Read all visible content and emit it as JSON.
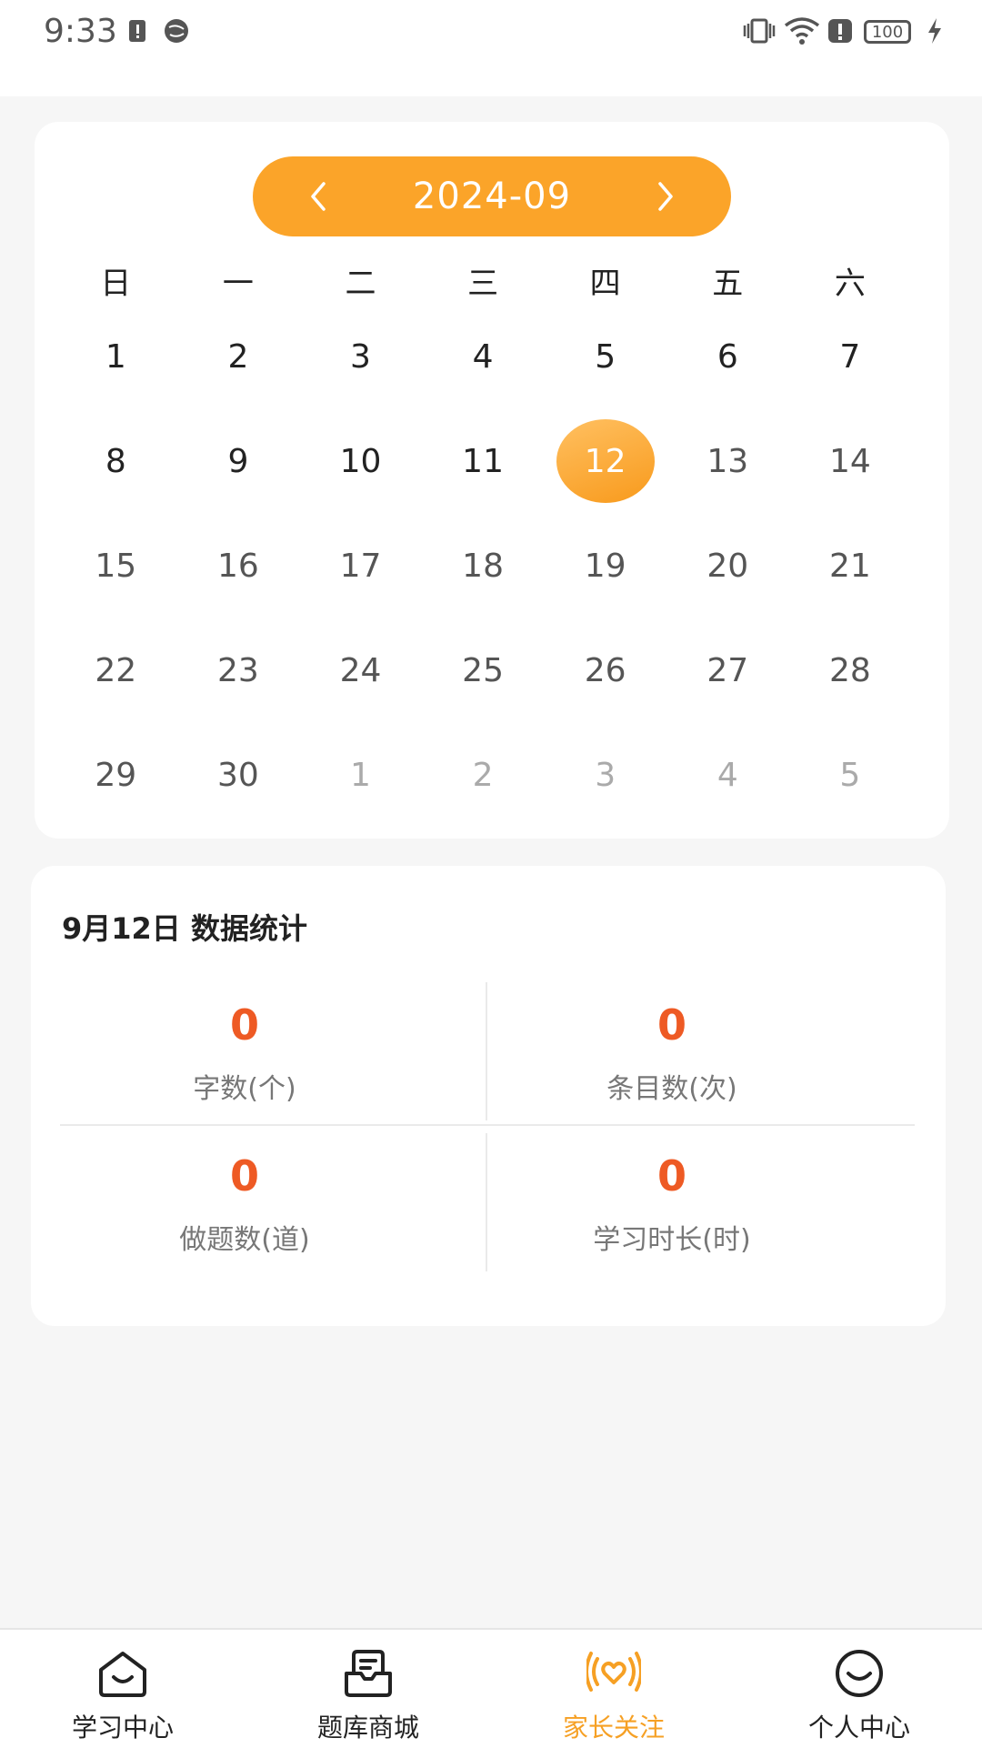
{
  "status_bar": {
    "time": "9:33",
    "battery": "100",
    "icons": [
      "sim-alert-icon",
      "globe-icon",
      "vibrate-icon",
      "wifi-icon",
      "alert-icon",
      "battery-icon",
      "charging-icon"
    ]
  },
  "calendar": {
    "month": "2024-09",
    "prev_icon": "chevron-left-icon",
    "next_icon": "chevron-right-icon",
    "weekdays": [
      "日",
      "一",
      "二",
      "三",
      "四",
      "五",
      "六"
    ],
    "weeks": [
      [
        "1",
        "2",
        "3",
        "4",
        "5",
        "6",
        "7"
      ],
      [
        "8",
        "9",
        "10",
        "11",
        "12",
        "13",
        "14"
      ],
      [
        "15",
        "16",
        "17",
        "18",
        "19",
        "20",
        "21"
      ],
      [
        "22",
        "23",
        "24",
        "25",
        "26",
        "27",
        "28"
      ],
      [
        "29",
        "30",
        "1",
        "2",
        "3",
        "4",
        "5"
      ]
    ],
    "selected_day": "12",
    "accent_color": "#fba429"
  },
  "stats": {
    "title": "9月12日  数据统计",
    "items": [
      {
        "value": "0",
        "label": "字数(个)"
      },
      {
        "value": "0",
        "label": "条目数(次)"
      },
      {
        "value": "0",
        "label": "做题数(道)"
      },
      {
        "value": "0",
        "label": "学习时长(时)"
      }
    ],
    "value_color": "#ee5a24"
  },
  "tab_bar": {
    "tabs": [
      {
        "label": "学习中心",
        "icon": "study-house-icon"
      },
      {
        "label": "题库商城",
        "icon": "question-bank-tray-icon"
      },
      {
        "label": "家长关注",
        "icon": "parent-heart-signal-icon"
      },
      {
        "label": "个人中心",
        "icon": "smile-face-icon"
      }
    ],
    "active_index": 2,
    "active_color": "#f6a024"
  }
}
